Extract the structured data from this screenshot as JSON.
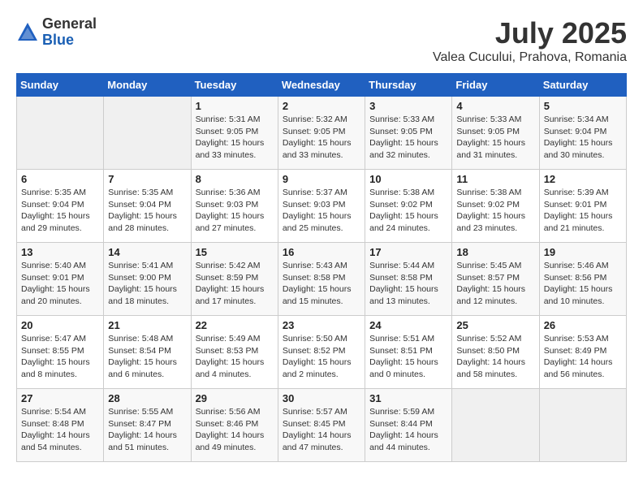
{
  "logo": {
    "general": "General",
    "blue": "Blue"
  },
  "title": {
    "month": "July 2025",
    "location": "Valea Cucului, Prahova, Romania"
  },
  "headers": [
    "Sunday",
    "Monday",
    "Tuesday",
    "Wednesday",
    "Thursday",
    "Friday",
    "Saturday"
  ],
  "weeks": [
    [
      {
        "day": "",
        "info": ""
      },
      {
        "day": "",
        "info": ""
      },
      {
        "day": "1",
        "info": "Sunrise: 5:31 AM\nSunset: 9:05 PM\nDaylight: 15 hours\nand 33 minutes."
      },
      {
        "day": "2",
        "info": "Sunrise: 5:32 AM\nSunset: 9:05 PM\nDaylight: 15 hours\nand 33 minutes."
      },
      {
        "day": "3",
        "info": "Sunrise: 5:33 AM\nSunset: 9:05 PM\nDaylight: 15 hours\nand 32 minutes."
      },
      {
        "day": "4",
        "info": "Sunrise: 5:33 AM\nSunset: 9:05 PM\nDaylight: 15 hours\nand 31 minutes."
      },
      {
        "day": "5",
        "info": "Sunrise: 5:34 AM\nSunset: 9:04 PM\nDaylight: 15 hours\nand 30 minutes."
      }
    ],
    [
      {
        "day": "6",
        "info": "Sunrise: 5:35 AM\nSunset: 9:04 PM\nDaylight: 15 hours\nand 29 minutes."
      },
      {
        "day": "7",
        "info": "Sunrise: 5:35 AM\nSunset: 9:04 PM\nDaylight: 15 hours\nand 28 minutes."
      },
      {
        "day": "8",
        "info": "Sunrise: 5:36 AM\nSunset: 9:03 PM\nDaylight: 15 hours\nand 27 minutes."
      },
      {
        "day": "9",
        "info": "Sunrise: 5:37 AM\nSunset: 9:03 PM\nDaylight: 15 hours\nand 25 minutes."
      },
      {
        "day": "10",
        "info": "Sunrise: 5:38 AM\nSunset: 9:02 PM\nDaylight: 15 hours\nand 24 minutes."
      },
      {
        "day": "11",
        "info": "Sunrise: 5:38 AM\nSunset: 9:02 PM\nDaylight: 15 hours\nand 23 minutes."
      },
      {
        "day": "12",
        "info": "Sunrise: 5:39 AM\nSunset: 9:01 PM\nDaylight: 15 hours\nand 21 minutes."
      }
    ],
    [
      {
        "day": "13",
        "info": "Sunrise: 5:40 AM\nSunset: 9:01 PM\nDaylight: 15 hours\nand 20 minutes."
      },
      {
        "day": "14",
        "info": "Sunrise: 5:41 AM\nSunset: 9:00 PM\nDaylight: 15 hours\nand 18 minutes."
      },
      {
        "day": "15",
        "info": "Sunrise: 5:42 AM\nSunset: 8:59 PM\nDaylight: 15 hours\nand 17 minutes."
      },
      {
        "day": "16",
        "info": "Sunrise: 5:43 AM\nSunset: 8:58 PM\nDaylight: 15 hours\nand 15 minutes."
      },
      {
        "day": "17",
        "info": "Sunrise: 5:44 AM\nSunset: 8:58 PM\nDaylight: 15 hours\nand 13 minutes."
      },
      {
        "day": "18",
        "info": "Sunrise: 5:45 AM\nSunset: 8:57 PM\nDaylight: 15 hours\nand 12 minutes."
      },
      {
        "day": "19",
        "info": "Sunrise: 5:46 AM\nSunset: 8:56 PM\nDaylight: 15 hours\nand 10 minutes."
      }
    ],
    [
      {
        "day": "20",
        "info": "Sunrise: 5:47 AM\nSunset: 8:55 PM\nDaylight: 15 hours\nand 8 minutes."
      },
      {
        "day": "21",
        "info": "Sunrise: 5:48 AM\nSunset: 8:54 PM\nDaylight: 15 hours\nand 6 minutes."
      },
      {
        "day": "22",
        "info": "Sunrise: 5:49 AM\nSunset: 8:53 PM\nDaylight: 15 hours\nand 4 minutes."
      },
      {
        "day": "23",
        "info": "Sunrise: 5:50 AM\nSunset: 8:52 PM\nDaylight: 15 hours\nand 2 minutes."
      },
      {
        "day": "24",
        "info": "Sunrise: 5:51 AM\nSunset: 8:51 PM\nDaylight: 15 hours\nand 0 minutes."
      },
      {
        "day": "25",
        "info": "Sunrise: 5:52 AM\nSunset: 8:50 PM\nDaylight: 14 hours\nand 58 minutes."
      },
      {
        "day": "26",
        "info": "Sunrise: 5:53 AM\nSunset: 8:49 PM\nDaylight: 14 hours\nand 56 minutes."
      }
    ],
    [
      {
        "day": "27",
        "info": "Sunrise: 5:54 AM\nSunset: 8:48 PM\nDaylight: 14 hours\nand 54 minutes."
      },
      {
        "day": "28",
        "info": "Sunrise: 5:55 AM\nSunset: 8:47 PM\nDaylight: 14 hours\nand 51 minutes."
      },
      {
        "day": "29",
        "info": "Sunrise: 5:56 AM\nSunset: 8:46 PM\nDaylight: 14 hours\nand 49 minutes."
      },
      {
        "day": "30",
        "info": "Sunrise: 5:57 AM\nSunset: 8:45 PM\nDaylight: 14 hours\nand 47 minutes."
      },
      {
        "day": "31",
        "info": "Sunrise: 5:59 AM\nSunset: 8:44 PM\nDaylight: 14 hours\nand 44 minutes."
      },
      {
        "day": "",
        "info": ""
      },
      {
        "day": "",
        "info": ""
      }
    ]
  ]
}
